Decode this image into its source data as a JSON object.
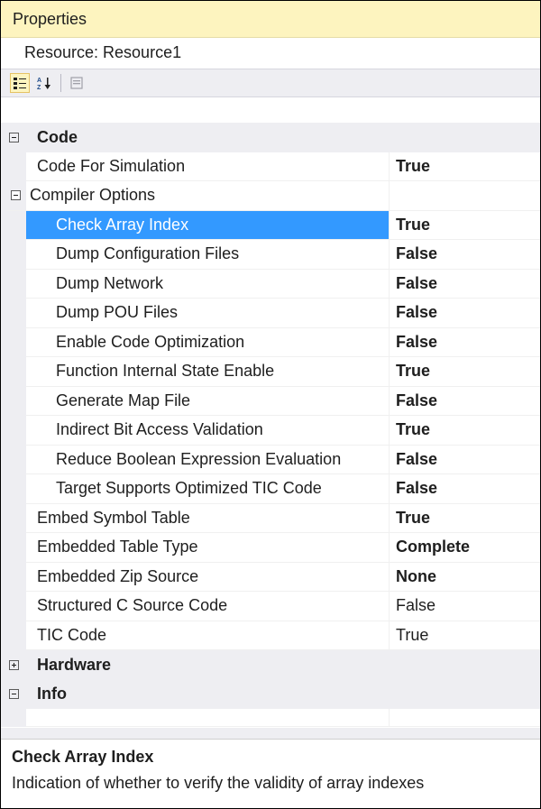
{
  "window": {
    "title": "Properties"
  },
  "resource_label": "Resource: Resource1",
  "toolbar": {
    "icons": [
      "categorized-icon",
      "alphabetical-sort-icon",
      "property-pages-icon"
    ]
  },
  "grid": {
    "rows": [
      {
        "type": "category",
        "label": "Code",
        "expanded": true
      },
      {
        "type": "property",
        "indent": 1,
        "name": "Code For Simulation",
        "value": "True",
        "value_bold": true
      },
      {
        "type": "subcategory",
        "indent": 1,
        "label": "Compiler Options",
        "expanded": true
      },
      {
        "type": "property",
        "indent": 2,
        "name": "Check Array Index",
        "value": "True",
        "value_bold": true,
        "selected": true
      },
      {
        "type": "property",
        "indent": 2,
        "name": "Dump Configuration Files",
        "value": "False",
        "value_bold": true
      },
      {
        "type": "property",
        "indent": 2,
        "name": "Dump Network",
        "value": "False",
        "value_bold": true
      },
      {
        "type": "property",
        "indent": 2,
        "name": "Dump POU Files",
        "value": "False",
        "value_bold": true
      },
      {
        "type": "property",
        "indent": 2,
        "name": "Enable Code Optimization",
        "value": "False",
        "value_bold": true
      },
      {
        "type": "property",
        "indent": 2,
        "name": "Function Internal State Enable",
        "value": "True",
        "value_bold": true
      },
      {
        "type": "property",
        "indent": 2,
        "name": "Generate Map File",
        "value": "False",
        "value_bold": true
      },
      {
        "type": "property",
        "indent": 2,
        "name": "Indirect Bit Access Validation",
        "value": "True",
        "value_bold": true
      },
      {
        "type": "property",
        "indent": 2,
        "name": "Reduce Boolean Expression Evaluation",
        "value": "False",
        "value_bold": true
      },
      {
        "type": "property",
        "indent": 2,
        "name": "Target Supports Optimized TIC Code",
        "value": "False",
        "value_bold": true
      },
      {
        "type": "property",
        "indent": 1,
        "name": "Embed Symbol Table",
        "value": "True",
        "value_bold": true
      },
      {
        "type": "property",
        "indent": 1,
        "name": "Embedded Table Type",
        "value": "Complete",
        "value_bold": true
      },
      {
        "type": "property",
        "indent": 1,
        "name": "Embedded Zip Source",
        "value": "None",
        "value_bold": true
      },
      {
        "type": "property",
        "indent": 1,
        "name": "Structured C Source Code",
        "value": "False",
        "value_bold": false
      },
      {
        "type": "property",
        "indent": 1,
        "name": "TIC Code",
        "value": "True",
        "value_bold": false
      },
      {
        "type": "category",
        "label": "Hardware",
        "expanded": false
      },
      {
        "type": "category",
        "label": "Info",
        "expanded": true
      },
      {
        "type": "empty"
      }
    ]
  },
  "description": {
    "title": "Check Array Index",
    "text": "Indication of whether to verify the validity of array indexes"
  },
  "colors": {
    "title_bar": "#fdf4bf",
    "selection": "#3399ff",
    "category_bg": "#eeeef2"
  }
}
